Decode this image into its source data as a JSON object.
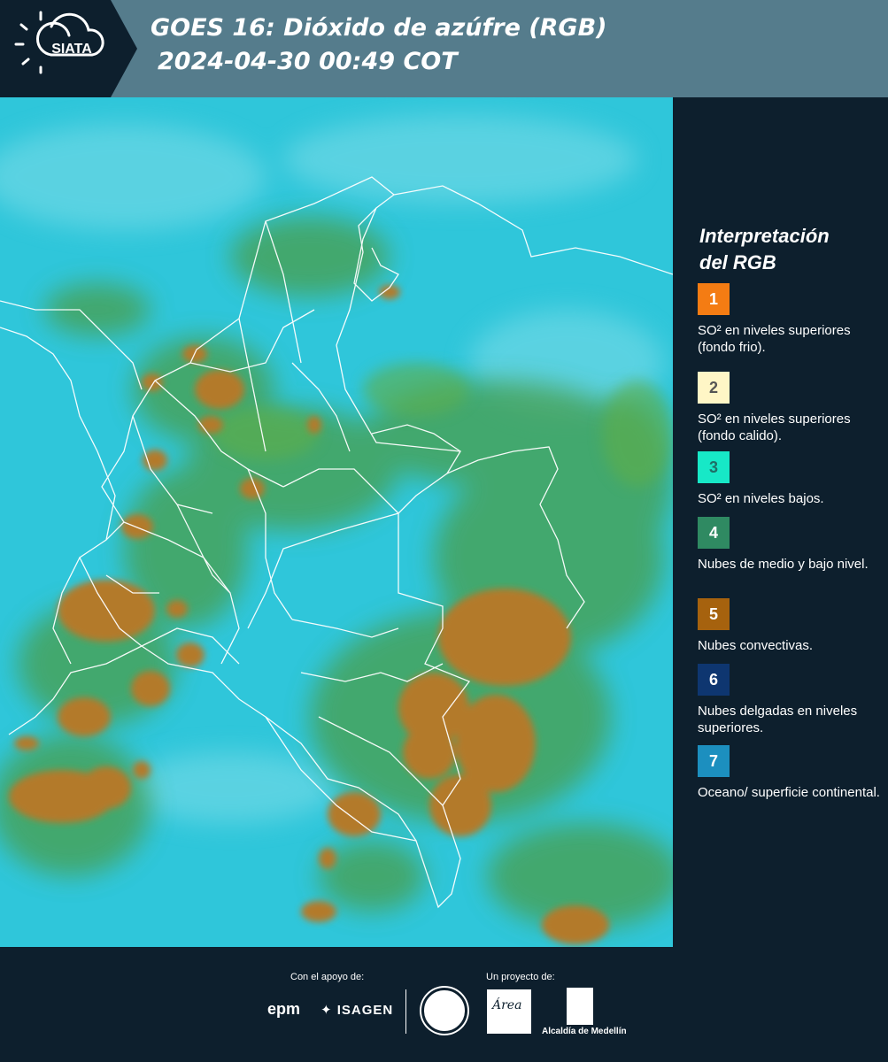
{
  "header": {
    "title_line1": "GOES 16: Dióxido de azúfre (RGB)",
    "title_line2": "2024-04-30 00:49 COT",
    "logo_text": "SIATA"
  },
  "legend": {
    "title_line1": "Interpretación",
    "title_line2": "del RGB",
    "items": [
      {
        "number": "1",
        "color": "#f47c13",
        "text_color": "#ffffff",
        "text": "SO² en niveles superiores (fondo frio)."
      },
      {
        "number": "2",
        "color": "#fff6c6",
        "text_color": "#555555",
        "text": "SO² en niveles superiores (fondo calido)."
      },
      {
        "number": "3",
        "color": "#17e8c7",
        "text_color": "#1f6e66",
        "text": "SO² en niveles bajos."
      },
      {
        "number": "4",
        "color": "#2f8a62",
        "text_color": "#ffffff",
        "text": "Nubes de medio y bajo nivel."
      },
      {
        "number": "5",
        "color": "#a6620e",
        "text_color": "#ffffff",
        "text": "Nubes convectivas."
      },
      {
        "number": "6",
        "color": "#0e3670",
        "text_color": "#ffffff",
        "text": "Nubes delgadas en niveles superiores."
      },
      {
        "number": "7",
        "color": "#1c8fbf",
        "text_color": "#ffffff",
        "text": "Oceano/ superficie continental."
      }
    ]
  },
  "footer": {
    "support_label": "Con el apoyo de:",
    "project_label": "Un proyecto de:",
    "sponsor1": "epm",
    "sponsor2": "ISAGEN",
    "partner_area": "Área",
    "partner_alcaldia": "Alcaldía de Medellín"
  },
  "colors": {
    "header_bg": "#557c8c",
    "panel_bg": "#0d1f2d",
    "ocean": "#2ec8dc",
    "cloud_mid": "#3f9a5a",
    "cloud_convective": "#b07a2a"
  }
}
